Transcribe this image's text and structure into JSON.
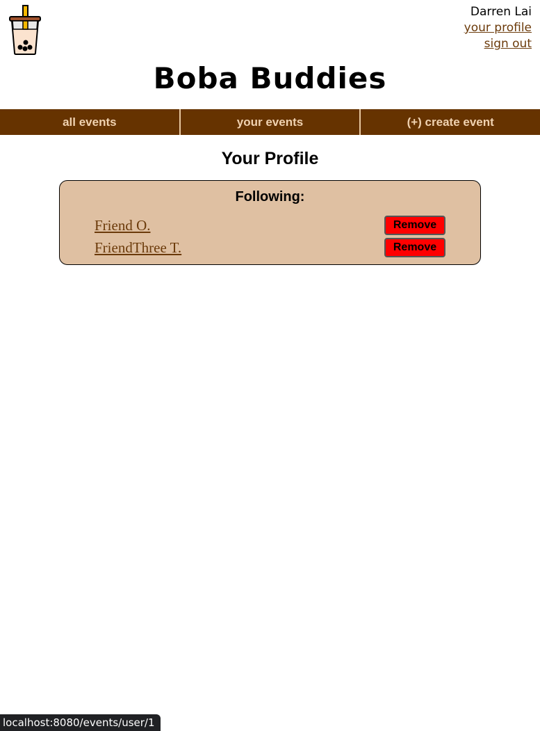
{
  "header": {
    "logo_icon": "boba-tea-icon",
    "user_name": "Darren Lai",
    "profile_link": "your profile",
    "signout_link": "sign out",
    "site_title": "Boba Buddies"
  },
  "nav": {
    "items": [
      {
        "label": "all events"
      },
      {
        "label": "your events"
      },
      {
        "label": "(+) create event"
      }
    ]
  },
  "main": {
    "page_title": "Your Profile",
    "following": {
      "title": "Following:",
      "items": [
        {
          "name": "Friend O.",
          "action": "Remove"
        },
        {
          "name": "FriendThree T.",
          "action": "Remove"
        }
      ]
    }
  },
  "status_bar": {
    "url": "localhost:8080/events/user/1"
  },
  "colors": {
    "nav_bg": "#663300",
    "nav_text": "#f0d2b0",
    "card_bg": "#dfc0a2",
    "link": "#6b3a0a",
    "remove_button": "#ff0000"
  }
}
